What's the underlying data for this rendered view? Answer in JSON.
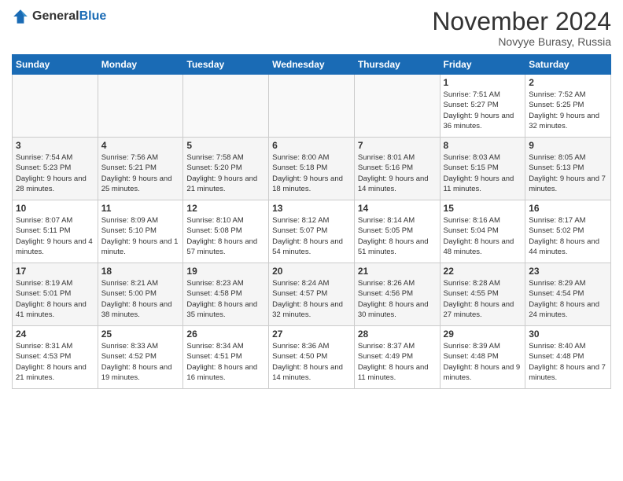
{
  "header": {
    "logo_general": "General",
    "logo_blue": "Blue",
    "month_title": "November 2024",
    "location": "Novyye Burasy, Russia"
  },
  "days_of_week": [
    "Sunday",
    "Monday",
    "Tuesday",
    "Wednesday",
    "Thursday",
    "Friday",
    "Saturday"
  ],
  "weeks": [
    [
      {
        "day": "",
        "info": ""
      },
      {
        "day": "",
        "info": ""
      },
      {
        "day": "",
        "info": ""
      },
      {
        "day": "",
        "info": ""
      },
      {
        "day": "",
        "info": ""
      },
      {
        "day": "1",
        "info": "Sunrise: 7:51 AM\nSunset: 5:27 PM\nDaylight: 9 hours and 36 minutes."
      },
      {
        "day": "2",
        "info": "Sunrise: 7:52 AM\nSunset: 5:25 PM\nDaylight: 9 hours and 32 minutes."
      }
    ],
    [
      {
        "day": "3",
        "info": "Sunrise: 7:54 AM\nSunset: 5:23 PM\nDaylight: 9 hours and 28 minutes."
      },
      {
        "day": "4",
        "info": "Sunrise: 7:56 AM\nSunset: 5:21 PM\nDaylight: 9 hours and 25 minutes."
      },
      {
        "day": "5",
        "info": "Sunrise: 7:58 AM\nSunset: 5:20 PM\nDaylight: 9 hours and 21 minutes."
      },
      {
        "day": "6",
        "info": "Sunrise: 8:00 AM\nSunset: 5:18 PM\nDaylight: 9 hours and 18 minutes."
      },
      {
        "day": "7",
        "info": "Sunrise: 8:01 AM\nSunset: 5:16 PM\nDaylight: 9 hours and 14 minutes."
      },
      {
        "day": "8",
        "info": "Sunrise: 8:03 AM\nSunset: 5:15 PM\nDaylight: 9 hours and 11 minutes."
      },
      {
        "day": "9",
        "info": "Sunrise: 8:05 AM\nSunset: 5:13 PM\nDaylight: 9 hours and 7 minutes."
      }
    ],
    [
      {
        "day": "10",
        "info": "Sunrise: 8:07 AM\nSunset: 5:11 PM\nDaylight: 9 hours and 4 minutes."
      },
      {
        "day": "11",
        "info": "Sunrise: 8:09 AM\nSunset: 5:10 PM\nDaylight: 9 hours and 1 minute."
      },
      {
        "day": "12",
        "info": "Sunrise: 8:10 AM\nSunset: 5:08 PM\nDaylight: 8 hours and 57 minutes."
      },
      {
        "day": "13",
        "info": "Sunrise: 8:12 AM\nSunset: 5:07 PM\nDaylight: 8 hours and 54 minutes."
      },
      {
        "day": "14",
        "info": "Sunrise: 8:14 AM\nSunset: 5:05 PM\nDaylight: 8 hours and 51 minutes."
      },
      {
        "day": "15",
        "info": "Sunrise: 8:16 AM\nSunset: 5:04 PM\nDaylight: 8 hours and 48 minutes."
      },
      {
        "day": "16",
        "info": "Sunrise: 8:17 AM\nSunset: 5:02 PM\nDaylight: 8 hours and 44 minutes."
      }
    ],
    [
      {
        "day": "17",
        "info": "Sunrise: 8:19 AM\nSunset: 5:01 PM\nDaylight: 8 hours and 41 minutes."
      },
      {
        "day": "18",
        "info": "Sunrise: 8:21 AM\nSunset: 5:00 PM\nDaylight: 8 hours and 38 minutes."
      },
      {
        "day": "19",
        "info": "Sunrise: 8:23 AM\nSunset: 4:58 PM\nDaylight: 8 hours and 35 minutes."
      },
      {
        "day": "20",
        "info": "Sunrise: 8:24 AM\nSunset: 4:57 PM\nDaylight: 8 hours and 32 minutes."
      },
      {
        "day": "21",
        "info": "Sunrise: 8:26 AM\nSunset: 4:56 PM\nDaylight: 8 hours and 30 minutes."
      },
      {
        "day": "22",
        "info": "Sunrise: 8:28 AM\nSunset: 4:55 PM\nDaylight: 8 hours and 27 minutes."
      },
      {
        "day": "23",
        "info": "Sunrise: 8:29 AM\nSunset: 4:54 PM\nDaylight: 8 hours and 24 minutes."
      }
    ],
    [
      {
        "day": "24",
        "info": "Sunrise: 8:31 AM\nSunset: 4:53 PM\nDaylight: 8 hours and 21 minutes."
      },
      {
        "day": "25",
        "info": "Sunrise: 8:33 AM\nSunset: 4:52 PM\nDaylight: 8 hours and 19 minutes."
      },
      {
        "day": "26",
        "info": "Sunrise: 8:34 AM\nSunset: 4:51 PM\nDaylight: 8 hours and 16 minutes."
      },
      {
        "day": "27",
        "info": "Sunrise: 8:36 AM\nSunset: 4:50 PM\nDaylight: 8 hours and 14 minutes."
      },
      {
        "day": "28",
        "info": "Sunrise: 8:37 AM\nSunset: 4:49 PM\nDaylight: 8 hours and 11 minutes."
      },
      {
        "day": "29",
        "info": "Sunrise: 8:39 AM\nSunset: 4:48 PM\nDaylight: 8 hours and 9 minutes."
      },
      {
        "day": "30",
        "info": "Sunrise: 8:40 AM\nSunset: 4:48 PM\nDaylight: 8 hours and 7 minutes."
      }
    ]
  ]
}
